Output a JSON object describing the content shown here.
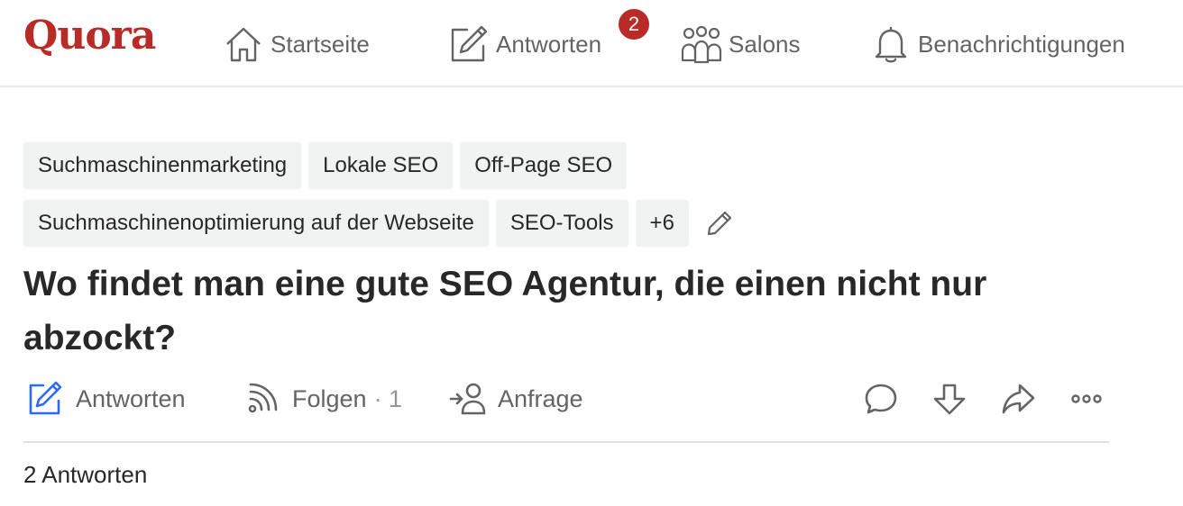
{
  "nav": {
    "logo": "Quora",
    "items": [
      {
        "label": "Startseite",
        "icon": "home-icon"
      },
      {
        "label": "Antworten",
        "icon": "pencil-square-icon",
        "badge": "2"
      },
      {
        "label": "Salons",
        "icon": "people-group-icon"
      },
      {
        "label": "Benachrichtigungen",
        "icon": "bell-icon"
      }
    ]
  },
  "topics": {
    "row1": [
      "Suchmaschinenmarketing",
      "Lokale SEO",
      "Off-Page SEO"
    ],
    "row2": [
      "Suchmaschinenoptimierung auf der Webseite",
      "SEO-Tools",
      "+6"
    ]
  },
  "question": {
    "title": "Wo findet man eine gute SEO Agentur, die einen nicht nur abzockt?"
  },
  "actions": {
    "answer_label": "Antworten",
    "follow_label": "Folgen",
    "follow_count": "· 1",
    "request_label": "Anfrage"
  },
  "answers": {
    "count_label": "2 Antworten"
  },
  "colors": {
    "brand": "#b92b27",
    "accent_blue": "#2e69ff",
    "text": "#282829",
    "muted": "#636466",
    "chip_bg": "#f1f2f2"
  }
}
